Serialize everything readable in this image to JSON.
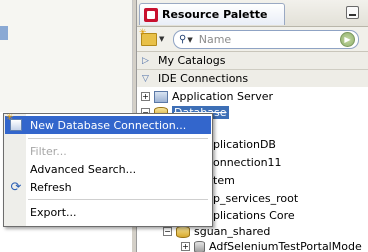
{
  "palette": {
    "title": "Resource Palette",
    "search_placeholder": "Name",
    "sections": {
      "my_catalogs": "My Catalogs",
      "ide_connections": "IDE Connections"
    },
    "tree": {
      "application_server": "Application Server",
      "database": "Database",
      "items": [
        "plicationDB",
        "onnection11",
        "tem",
        "p_services_root",
        "plications Core"
      ],
      "sguan_shared": "sguan_shared",
      "adf_selenium": "AdfSeleniumTestPortalMode"
    }
  },
  "context_menu": {
    "new_db_connection": "New Database Connection...",
    "filter": "Filter...",
    "advanced_search": "Advanced Search...",
    "refresh": "Refresh",
    "export": "Export..."
  }
}
